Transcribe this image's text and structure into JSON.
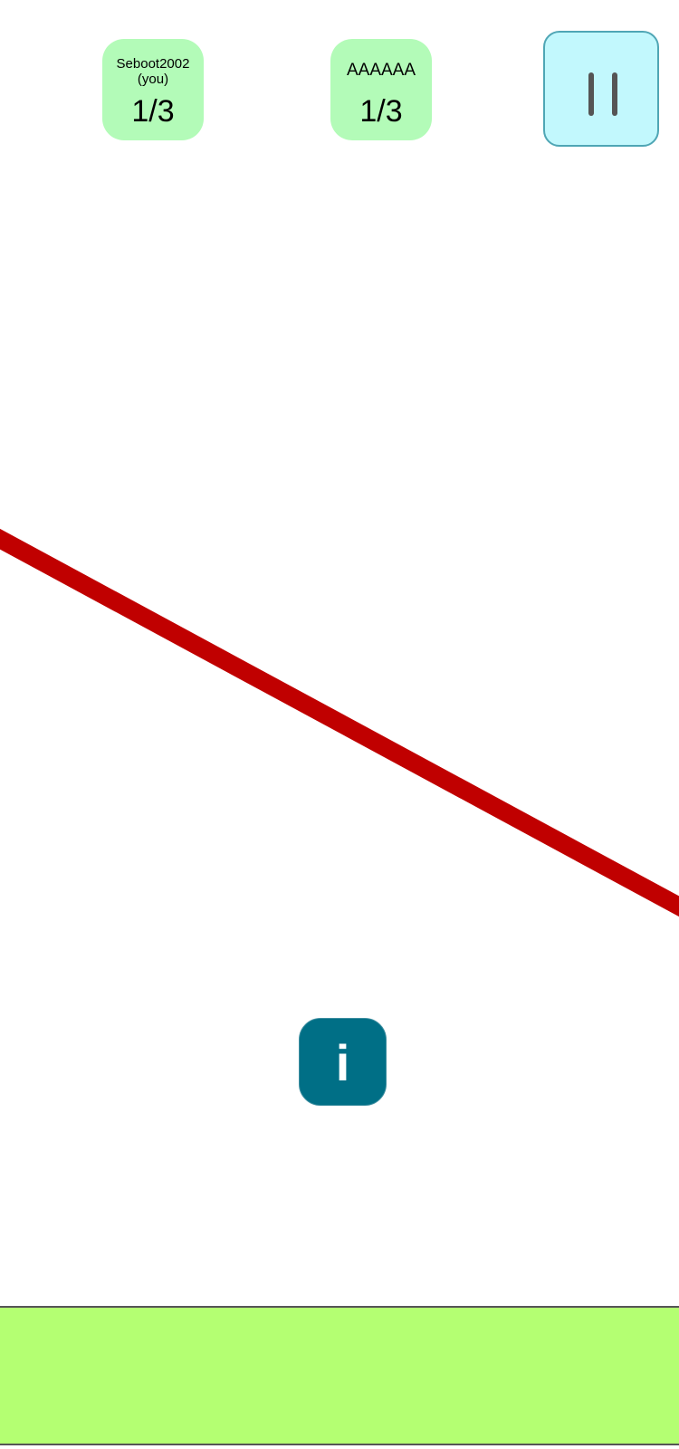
{
  "players": [
    {
      "name": "Seboot2002",
      "tag": "(you)",
      "score": "1/3"
    },
    {
      "name": "AAAAAA",
      "tag": "",
      "score": "1/3"
    }
  ],
  "controls": {
    "pause_icon": "pause-icon",
    "info_label": "i",
    "info_icon": "info-icon"
  },
  "colors": {
    "player_card_bg": "#b3fbb8",
    "pause_button_bg": "#c2f8fd",
    "info_button_bg": "#006f86",
    "line": "#c00000",
    "ground": "#b4ff72"
  }
}
